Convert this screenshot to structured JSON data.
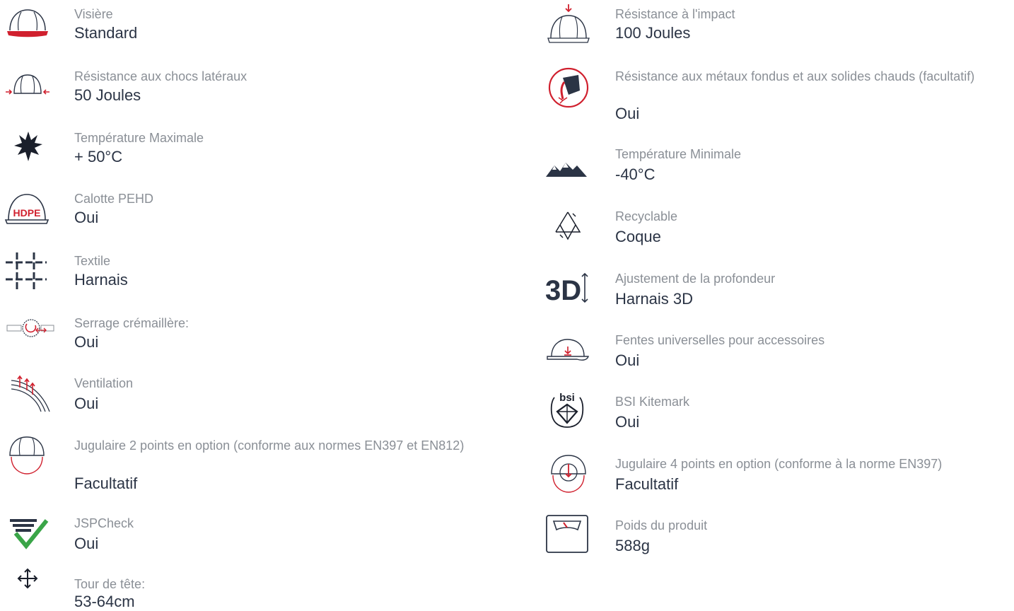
{
  "left": [
    {
      "label": "Visière",
      "value": "Standard",
      "icon": "visor-helmet-icon"
    },
    {
      "label": "Résistance aux chocs latéraux",
      "value": "50 Joules",
      "icon": "lateral-impact-helmet-icon"
    },
    {
      "label": "Température Maximale",
      "value": "+ 50°C",
      "icon": "sun-icon"
    },
    {
      "label": "Calotte PEHD",
      "value": "Oui",
      "icon": "hdpe-helmet-icon"
    },
    {
      "label": "Textile",
      "value": "Harnais",
      "icon": "textile-weave-icon"
    },
    {
      "label": "Serrage crémaillère:",
      "value": "Oui",
      "icon": "ratchet-icon"
    },
    {
      "label": "Ventilation",
      "value": "Oui",
      "icon": "ventilation-icon"
    },
    {
      "label": "Jugulaire 2 points en option (conforme aux normes EN397 et EN812)",
      "value": "Facultatif",
      "icon": "chinstrap-2pt-helmet-icon"
    },
    {
      "label": "JSPCheck",
      "value": "Oui",
      "icon": "jspcheck-icon"
    },
    {
      "label": "Tour de tête:",
      "value": "53-64cm",
      "icon": "move-arrows-icon"
    }
  ],
  "right": [
    {
      "label": "Résistance à l'impact",
      "value": "100 Joules",
      "icon": "impact-helmet-icon"
    },
    {
      "label": "Résistance aux métaux fondus et aux solides chauds (facultatif)",
      "value": "Oui",
      "icon": "molten-metal-icon"
    },
    {
      "label": "Température Minimale",
      "value": "-40°C",
      "icon": "mountains-icon"
    },
    {
      "label": "Recyclable",
      "value": "Coque",
      "icon": "recycle-icon"
    },
    {
      "label": "Ajustement de la profondeur",
      "value": "Harnais 3D",
      "icon": "3d-depth-icon"
    },
    {
      "label": "Fentes universelles pour accessoires",
      "value": "Oui",
      "icon": "accessory-slot-helmet-icon"
    },
    {
      "label": "BSI Kitemark",
      "value": "Oui",
      "icon": "bsi-kitemark-icon"
    },
    {
      "label": "Jugulaire 4 points en option (conforme à la norme EN397)",
      "value": "Facultatif",
      "icon": "chinstrap-4pt-helmet-icon"
    },
    {
      "label": "Poids du produit",
      "value": "588g",
      "icon": "weighing-scale-icon"
    }
  ],
  "icon_text": {
    "hdpe": "HDPE",
    "bsi": "bsi",
    "three_d": "3D"
  },
  "colors": {
    "accent_red": "#d0202e",
    "icon_navy": "#2b3445",
    "check_green": "#3aa548",
    "label_grey": "#8a8f96"
  }
}
